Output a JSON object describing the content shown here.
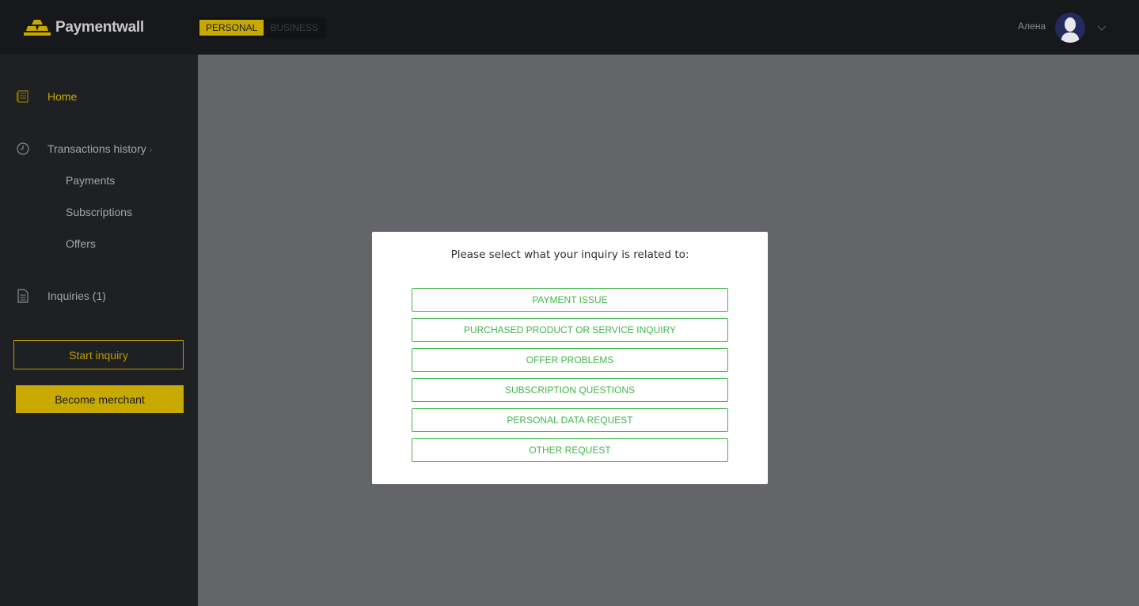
{
  "brand": {
    "name": "Paymentwall",
    "accent": "#c7a900"
  },
  "mode_switch": {
    "personal": "PERSONAL",
    "business": "BUSINESS",
    "selected": "PERSONAL"
  },
  "user": {
    "name": "Алена"
  },
  "sidebar": {
    "home": "Home",
    "transactions_history": "Transactions history",
    "sub_items": [
      "Payments",
      "Subscriptions",
      "Offers"
    ],
    "inquiries": "Inquiries (1)",
    "start_inquiry": "Start inquiry",
    "become_merchant": "Become merchant"
  },
  "modal": {
    "title": "Please select what your inquiry is related to:",
    "options": [
      "PAYMENT ISSUE",
      "PURCHASED PRODUCT OR SERVICE INQUIRY",
      "OFFER PROBLEMS",
      "SUBSCRIPTION QUESTIONS",
      "PERSONAL DATA REQUEST",
      "OTHER REQUEST"
    ],
    "option_color": "#43b649"
  },
  "icons": {
    "logo": "paymentwall-logo-icon",
    "home": "book-icon",
    "history": "clock-icon",
    "inquiries": "document-icon",
    "user_menu": "chevron-down-icon"
  }
}
